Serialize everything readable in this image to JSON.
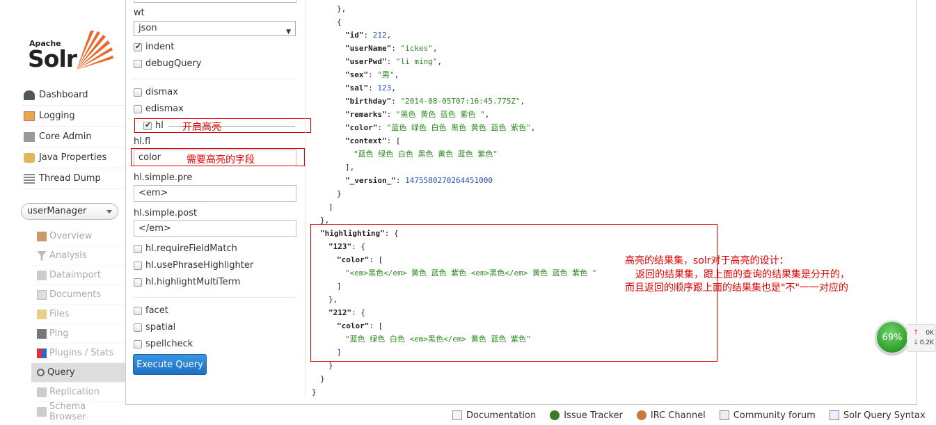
{
  "logo": {
    "apache": "Apache",
    "solr": "Solr"
  },
  "nav": [
    {
      "label": "Dashboard",
      "icon": "dashboard-icon"
    },
    {
      "label": "Logging",
      "icon": "logging-icon"
    },
    {
      "label": "Core Admin",
      "icon": "core-admin-icon"
    },
    {
      "label": "Java Properties",
      "icon": "java-properties-icon"
    },
    {
      "label": "Thread Dump",
      "icon": "thread-dump-icon"
    }
  ],
  "core_select": {
    "value": "userManager"
  },
  "subnav": [
    {
      "label": "Overview",
      "icon": "home-icon"
    },
    {
      "label": "Analysis",
      "icon": "filter-icon"
    },
    {
      "label": "Dataimport",
      "icon": "dataimport-icon"
    },
    {
      "label": "Documents",
      "icon": "documents-icon"
    },
    {
      "label": "Files",
      "icon": "folder-icon"
    },
    {
      "label": "Ping",
      "icon": "ping-icon"
    },
    {
      "label": "Plugins / Stats",
      "icon": "plugins-icon"
    },
    {
      "label": "Query",
      "icon": "search-icon"
    },
    {
      "label": "Replication",
      "icon": "replication-icon"
    },
    {
      "label": "Schema Browser",
      "icon": "schema-icon"
    }
  ],
  "form": {
    "wt_label": "wt",
    "wt_value": "json",
    "indent": "indent",
    "debugQuery": "debugQuery",
    "dismax": "dismax",
    "edismax": "edismax",
    "hl": "hl",
    "hl_fl_label": "hl.fl",
    "hl_fl_value": "color",
    "hl_pre_label": "hl.simple.pre",
    "hl_pre_value": "<em>",
    "hl_post_label": "hl.simple.post",
    "hl_post_value": "</em>",
    "requireFieldMatch": "hl.requireFieldMatch",
    "usePhraseHighlighter": "hl.usePhraseHighlighter",
    "highlightMultiTerm": "hl.highlightMultiTerm",
    "facet": "facet",
    "spatial": "spatial",
    "spellcheck": "spellcheck",
    "execute": "Execute Query"
  },
  "annotations": {
    "hl_note": "开启高亮",
    "fl_note": "需要高亮的字段",
    "result_note_1": "高亮的结果集，solr对于高亮的设计：",
    "result_note_2": "返回的结果集，跟上面的查询的结果集是分开的，",
    "result_note_3": "而且返回的顺序跟上面的结果集也是\"不\"一一对应的"
  },
  "json": {
    "close_brace_comma": "},",
    "open_brace": "{",
    "id_key": "\"id\"",
    "id_val": "212",
    "userName_key": "\"userName\"",
    "userName_val": "\"ickes\"",
    "userPwd_key": "\"userPwd\"",
    "userPwd_val": "\"li ming\"",
    "sex_key": "\"sex\"",
    "sex_val": "\"男\"",
    "sal_key": "\"sal\"",
    "sal_val": "123",
    "birthday_key": "\"birthday\"",
    "birthday_val": "\"2014-08-05T07:16:45.775Z\"",
    "remarks_key": "\"remarks\"",
    "remarks_val": "\"黑色 黄色 蓝色 紫色 \"",
    "color_key": "\"color\"",
    "color_val": "\"蓝色 绿色 白色 黑色 黄色 蓝色 紫色\"",
    "context_key": "\"context\"",
    "open_bracket": "[",
    "context_val": "\"蓝色 绿色 白色 黑色 黄色 蓝色 紫色\"",
    "close_bracket_comma": "],",
    "version_key": "\"_version_\"",
    "version_val": "1475580270264451000",
    "close_brace": "}",
    "close_bracket": "]",
    "highlighting_key": "\"highlighting\"",
    "hl_123_key": "\"123\"",
    "hl_color_key": "\"color\"",
    "hl_123_val": "\"<em>黑色</em> 黄色 蓝色 紫色 <em>黑色</em> 黄色 蓝色 紫色 \"",
    "hl_212_key": "\"212\"",
    "hl_212_val": "\"蓝色 绿色 白色 <em>黑色</em> 黄色 蓝色 紫色\""
  },
  "footer": [
    {
      "label": "Documentation",
      "icon": "documentation-icon"
    },
    {
      "label": "Issue Tracker",
      "icon": "bug-icon"
    },
    {
      "label": "IRC Channel",
      "icon": "irc-icon"
    },
    {
      "label": "Community forum",
      "icon": "mail-icon"
    },
    {
      "label": "Solr Query Syntax",
      "icon": "syntax-icon"
    }
  ],
  "widget": {
    "percent": "69%",
    "up": "0K",
    "down": "0.2K"
  },
  "colors": {
    "accent": "#1d6fc4",
    "annotation": "#dd0000",
    "string": "#2b8a1e",
    "number": "#1f4fb8"
  }
}
